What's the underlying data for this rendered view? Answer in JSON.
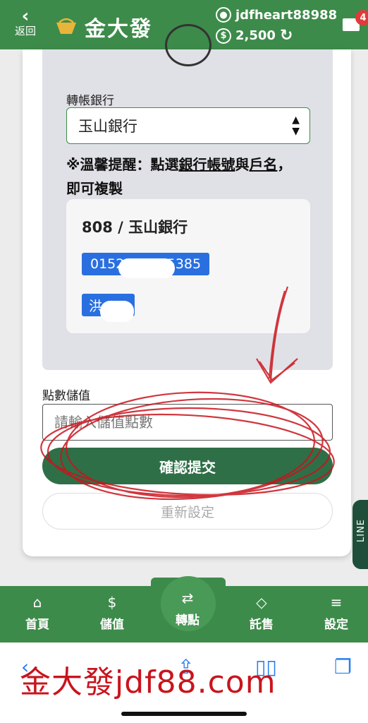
{
  "header": {
    "back_label": "返回",
    "logo_text": "金大發",
    "username": "jdfheart88988",
    "coins": "2,500",
    "mail_badge": "4"
  },
  "transfer": {
    "bank_label": "轉帳銀行",
    "bank_selected": "玉山銀行",
    "tip_prefix": "※溫馨提醒：點選",
    "tip_link": "銀行帳號",
    "tip_and": "與",
    "tip_link2": "戶名",
    "tip_suffix": "，即可複製",
    "account_code": "808 / 玉山銀行",
    "account_number": "0152          5385",
    "account_name": "洪"
  },
  "points": {
    "label": "點數儲值",
    "placeholder": "請輸入儲值點數",
    "submit_label": "確認提交",
    "reset_label": "重新設定"
  },
  "line_tab": "LINE",
  "nav": {
    "items": [
      {
        "label": "首頁",
        "icon": "home-icon"
      },
      {
        "label": "儲值",
        "icon": "coin-plus-icon"
      },
      {
        "label": "轉點",
        "icon": "transfer-icon"
      },
      {
        "label": "託售",
        "icon": "diamond-icon"
      },
      {
        "label": "設定",
        "icon": "settings-icon"
      }
    ]
  },
  "watermark": "金大發jdf88.com",
  "colors": {
    "brand_green": "#3d8b4a",
    "button_green": "#2f6f47",
    "account_blue": "#2a6fe0",
    "annotation_red": "#c9141d"
  }
}
